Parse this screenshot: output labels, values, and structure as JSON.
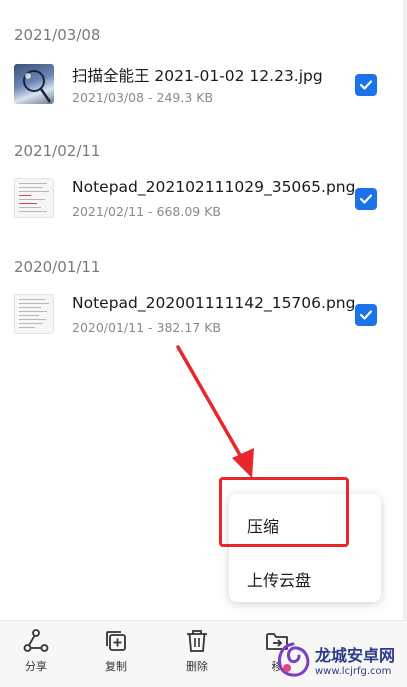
{
  "groups": [
    {
      "date": "2021/03/08",
      "file": {
        "name": "扫描全能王 2021-01-02 12.23.jpg",
        "meta": "2021/03/08 - 249.3 KB",
        "checked": true,
        "thumb": "photo"
      }
    },
    {
      "date": "2021/02/11",
      "file": {
        "name": "Notepad_202102111029_35065.png",
        "meta": "2021/02/11 - 668.09 KB",
        "checked": true,
        "thumb": "doc"
      }
    },
    {
      "date": "2020/01/11",
      "file": {
        "name": "Notepad_202001111142_15706.png",
        "meta": "2020/01/11 - 382.17 KB",
        "checked": true,
        "thumb": "doc"
      }
    }
  ],
  "popup_menu": {
    "items": [
      {
        "label": "压缩"
      },
      {
        "label": "上传云盘"
      }
    ]
  },
  "toolbar": {
    "items": [
      {
        "label": "分享",
        "icon": "share-icon"
      },
      {
        "label": "复制",
        "icon": "copy-icon"
      },
      {
        "label": "删除",
        "icon": "delete-icon"
      },
      {
        "label": "移",
        "icon": "move-icon"
      }
    ]
  },
  "watermark": {
    "text": "龙城安卓网",
    "url": "www.lcjrfg.com"
  },
  "colors": {
    "accent": "#1a73e8",
    "annotation": "#e8262b"
  }
}
